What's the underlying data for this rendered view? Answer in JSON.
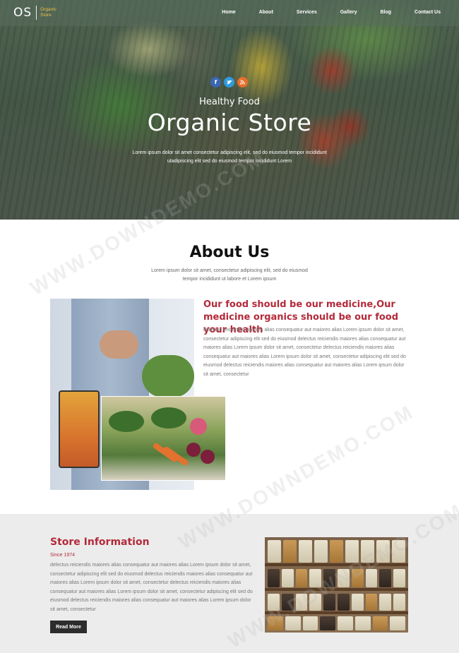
{
  "brand": {
    "mark": "OS",
    "line1": "Organic",
    "line2": "Store"
  },
  "nav": [
    "Home",
    "About",
    "Services",
    "Gallery",
    "Blog",
    "Contact Us"
  ],
  "social": [
    {
      "icon": "facebook-icon",
      "glyph": "f",
      "color": "#3b66b5"
    },
    {
      "icon": "twitter-icon",
      "glyph": "t",
      "color": "#2f9be0"
    },
    {
      "icon": "rss-icon",
      "glyph": "r",
      "color": "#e86e2c"
    }
  ],
  "hero": {
    "subtitle": "Healthy Food",
    "title": "Organic Store",
    "description": "Lorem ipsum dolor sit amet consectetur adipiscing elit, sed do eiusmod tempor incididunt utadipiscing elit sed do eiusmod tempor incididunt Lorem"
  },
  "about": {
    "title": "About Us",
    "intro": "Lorem ipsum dolor sit amet, consectetur adipiscing elit, sed do eiusmod tempor incididunt ut labore et Lorem ipsum",
    "heading": "Our food should be our medicine,Our medicine organics should be our food your health",
    "text": "delectus reiciendis maiores alias consequatur aut maiores alias Lorem ipsum dolor sit amet, consectetur adipiscing elit sed do eiusmod delectus reiciendis maiores alias consequatur aut maiores alias Lorem ipsum dolor sit amet, consectetur delectus reiciendis maiores alias consequatur aut maiores alias Lorem ipsum dolor sit amet, consectetur adipiscing elit sed do eiusmod delectus reiciendis maiores alias consequatur aut maiores alias Lorem ipsum dolor sit amet, consectetur"
  },
  "store": {
    "title": "Store Information",
    "since": "Since 1974",
    "text": "delectus reiciendis maiores alias consequatur aut maiores alias Lorem ipsum dolor sit amet, consectetur adipiscing elit sed do eiusmod delectus reiciendis maiores alias consequatur aut maiores alias Lorem ipsum dolor sit amet, consectetur delectus reiciendis maiores alias consequatur aut maiores alias Lorem ipsum dolor sit amet, consectetur adipiscing elit sed do eiusmod delectus reiciendis maiores alias consequatur aut maiores alias Lorem ipsum dolor sit amet, consectetur",
    "button": "Read More"
  },
  "watermark": "WWW.DOWNDEMO.COM",
  "colors": {
    "accent": "#b32a3a",
    "logo_text": "#e8c14b",
    "store_bg": "#ececec"
  }
}
